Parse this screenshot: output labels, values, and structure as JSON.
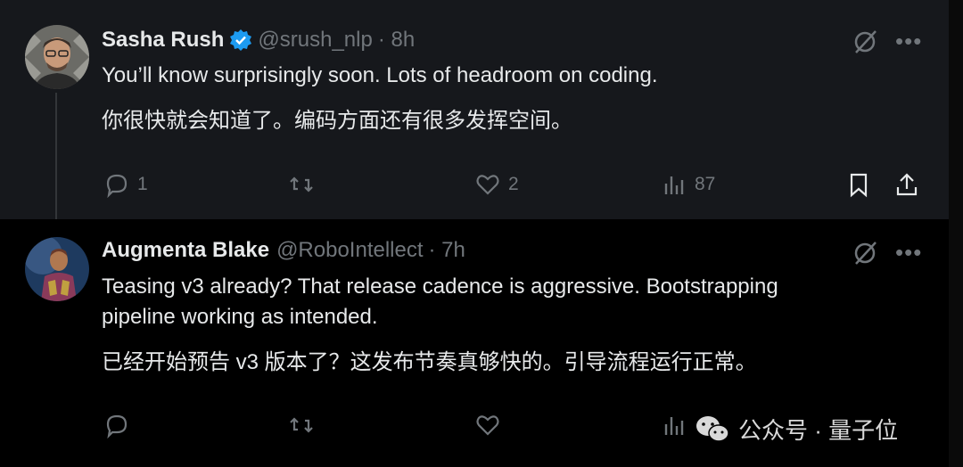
{
  "tweets": [
    {
      "author": "Sasha Rush",
      "handle": "@srush_nlp",
      "time": "· 8h",
      "verified": true,
      "text_en": "You’ll know surprisingly soon. Lots of headroom on coding.",
      "text_zh": "你很快就会知道了。编码方面还有很多发挥空间。",
      "replies": "1",
      "retweets": "",
      "likes": "2",
      "views": "87"
    },
    {
      "author": "Augmenta Blake",
      "handle": "@RoboIntellect",
      "time": "· 7h",
      "verified": false,
      "text_en_line1": "Teasing v3 already? That release cadence is aggressive. Bootstrapping",
      "text_en_line2": "pipeline working as intended.",
      "text_zh": "已经开始预告 v3 版本了？这发布节奏真够快的。引导流程运行正常。"
    }
  ],
  "watermark": "公众号 · 量子位",
  "icons": {
    "grok": "grok-icon",
    "more": "more-icon",
    "reply": "reply-icon",
    "retweet": "retweet-icon",
    "like": "like-icon",
    "views": "views-icon",
    "bookmark": "bookmark-icon",
    "share": "share-icon"
  },
  "colors": {
    "verified": "#1d9bf0",
    "muted": "#71767b",
    "text": "#e7e9ea",
    "highlight_bg": "#16181c"
  }
}
